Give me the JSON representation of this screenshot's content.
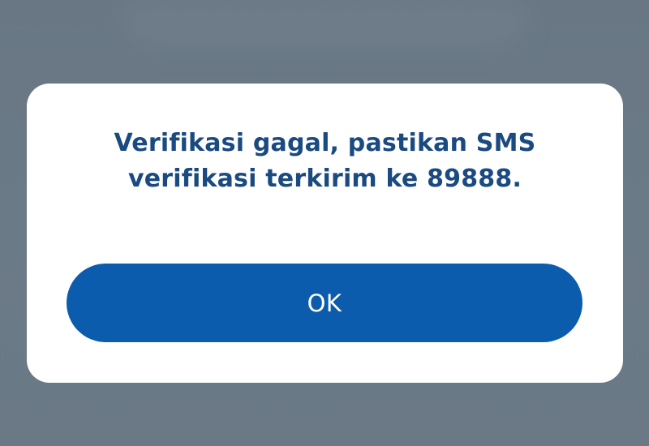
{
  "dialog": {
    "message_line1": "Verifikasi gagal, pastikan SMS",
    "message_line2": "verifikasi terkirim ke 89888.",
    "ok_label": "OK"
  },
  "colors": {
    "backdrop": "#6b7a86",
    "dialog_background": "#ffffff",
    "message_text": "#1a4a80",
    "button_background": "#0b5cad",
    "button_text": "#ffffff"
  }
}
